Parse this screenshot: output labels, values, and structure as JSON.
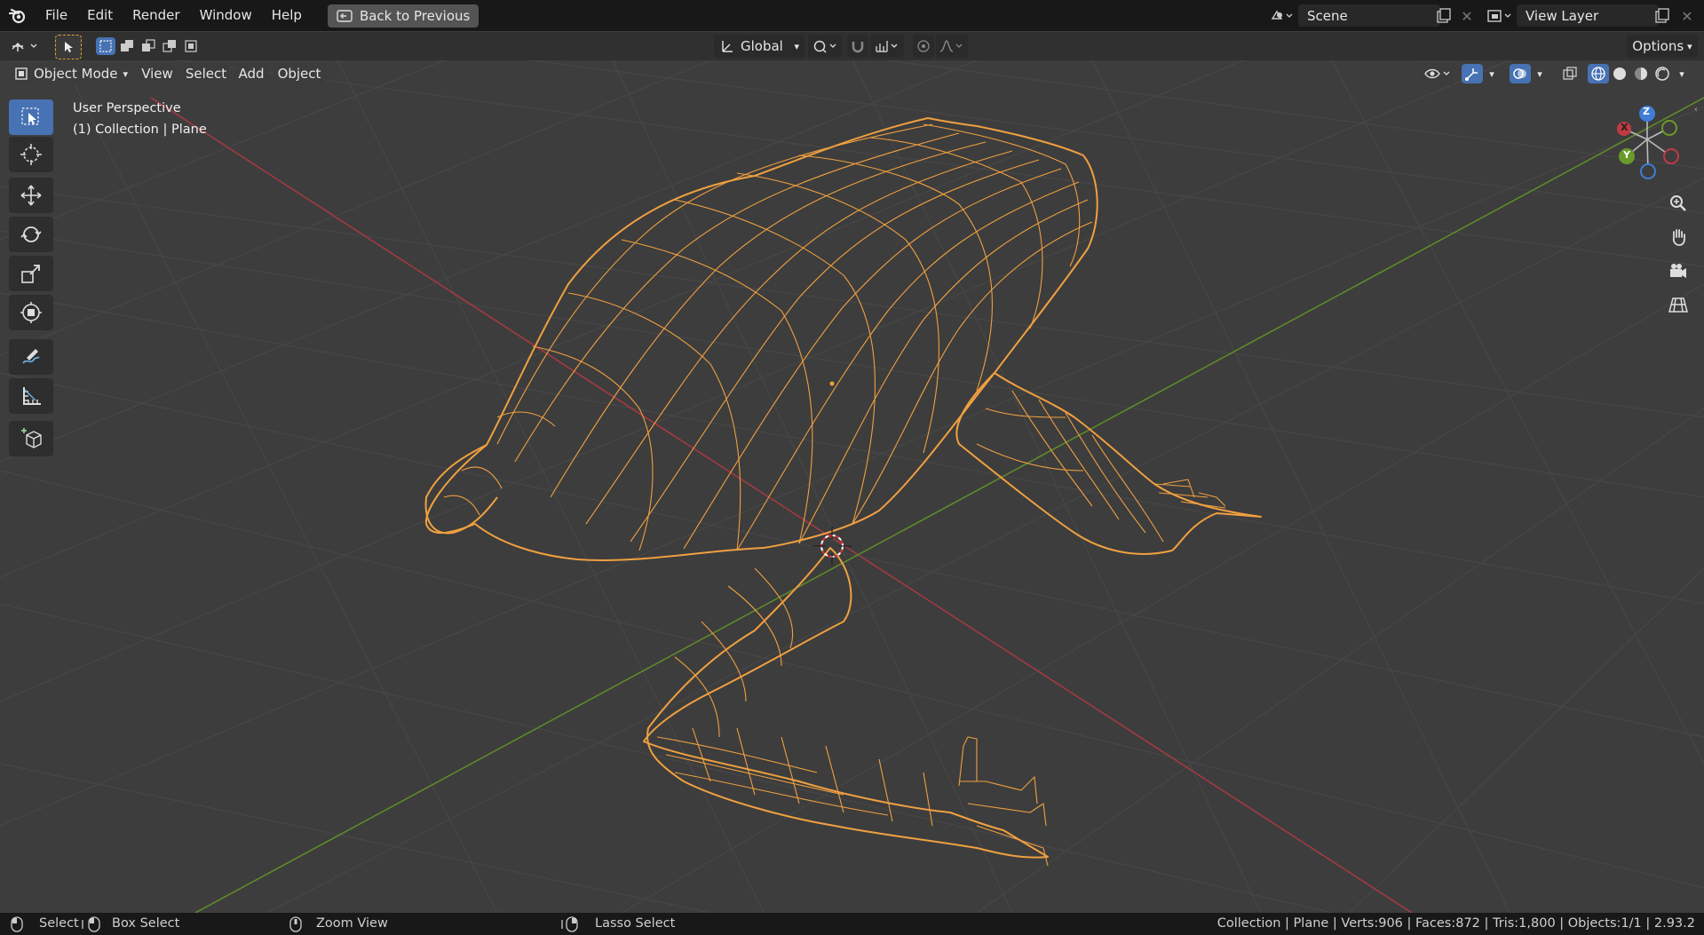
{
  "menu": {
    "items": [
      "File",
      "Edit",
      "Render",
      "Window",
      "Help"
    ],
    "back_label": "Back to Previous"
  },
  "scene": {
    "value": "Scene"
  },
  "view_layer": {
    "value": "View Layer"
  },
  "header": {
    "transform_orientation": "Global",
    "options_label": "Options",
    "mode": "Object Mode",
    "view_menu": [
      "View",
      "Select",
      "Add",
      "Object"
    ]
  },
  "viewport": {
    "perspective_label": "User Perspective",
    "collection_label": "(1) Collection | Plane",
    "gizmo": {
      "x": "X",
      "y": "Y",
      "z": "Z"
    }
  },
  "status": {
    "select": "Select",
    "box_select": "Box Select",
    "zoom_view": "Zoom View",
    "lasso_select": "Lasso Select",
    "stats": "Collection | Plane | Verts:906 | Faces:872 | Tris:1,800 | Objects:1/1 | 2.93.2"
  },
  "colors": {
    "accent": "#4772b3",
    "wireframe": "#f5a033",
    "x_axis": "#c23a44",
    "y_axis": "#6a9a2a",
    "z_axis": "#3f7dd6"
  }
}
